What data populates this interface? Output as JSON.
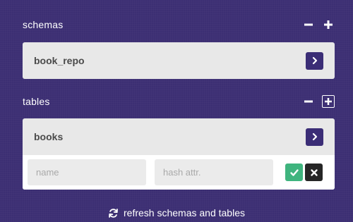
{
  "schemas": {
    "title": "schemas",
    "items": [
      {
        "label": "book_repo"
      }
    ]
  },
  "tables": {
    "title": "tables",
    "items": [
      {
        "label": "books"
      }
    ],
    "new_table_form": {
      "name_placeholder": "name",
      "hash_placeholder": "hash attr.",
      "name_value": "",
      "hash_value": ""
    }
  },
  "footer": {
    "refresh_label": "refresh schemas and tables"
  },
  "icons": {
    "collapse": "minus-icon",
    "add": "plus-icon",
    "open": "chevron-right-icon",
    "confirm": "checkmark-icon",
    "cancel": "close-icon",
    "refresh": "refresh-icon"
  },
  "colors": {
    "background": "#3c2f73",
    "card": "#e8e8e8",
    "accent": "#3b2d76",
    "confirm": "#3fb47e",
    "cancel": "#262626"
  }
}
